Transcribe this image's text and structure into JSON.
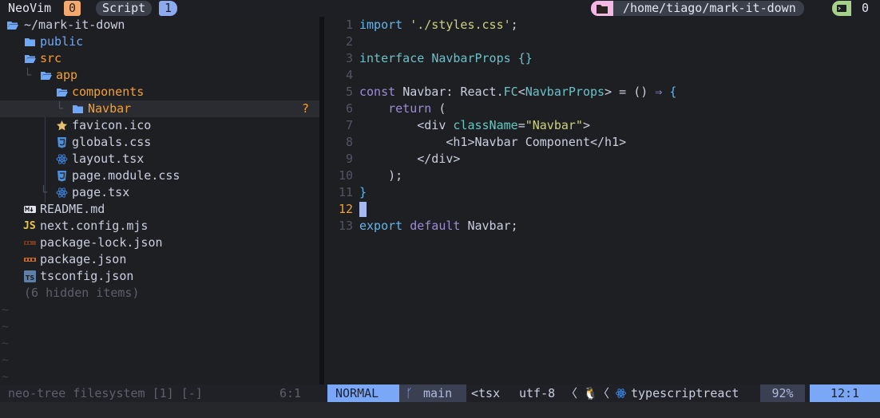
{
  "topbar": {
    "app_name": "NeoVim",
    "app_badge": "0",
    "session_name": "Script",
    "session_badge": "1",
    "path": "/home/tiago/mark-it-down",
    "terminal_count": "0"
  },
  "tree": {
    "root": "~/mark-it-down",
    "items": [
      {
        "label": "public"
      },
      {
        "label": "src"
      },
      {
        "label": "app"
      },
      {
        "label": "components"
      },
      {
        "label": "Navbar",
        "status": "?"
      },
      {
        "label": "favicon.ico"
      },
      {
        "label": "globals.css"
      },
      {
        "label": "layout.tsx"
      },
      {
        "label": "page.module.css"
      },
      {
        "label": "page.tsx"
      },
      {
        "label": "README.md"
      },
      {
        "label": "next.config.mjs"
      },
      {
        "label": "package-lock.json"
      },
      {
        "label": "package.json"
      },
      {
        "label": "tsconfig.json"
      }
    ],
    "hidden": "(6 hidden items)",
    "empty_marker": "~"
  },
  "editor": {
    "line_numbers": [
      "1",
      "2",
      "3",
      "4",
      "5",
      "6",
      "7",
      "8",
      "9",
      "10",
      "11",
      "12",
      "13"
    ],
    "tokens": {
      "l1_import": "import",
      "l1_str": "'./styles.css'",
      "l1_semi": ";",
      "l3_interface": "interface",
      "l3_name": "NavbarProps",
      "l3_braces": "{}",
      "l5_const": "const",
      "l5_navbar": "Navbar",
      "l5_colon": ":",
      "l5_react": "React",
      "l5_dot": ".",
      "l5_fc": "FC",
      "l5_lt": "<",
      "l5_props": "NavbarProps",
      "l5_gt": ">",
      "l5_eq": "=",
      "l5_parens": "()",
      "l5_arrow": "⇒",
      "l5_brace": "{",
      "l6_return": "return",
      "l6_paren": "(",
      "l7_open": "<div",
      "l7_attr": "className",
      "l7_eq": "=",
      "l7_val": "\"Navbar\"",
      "l7_close": ">",
      "l8_text": "<h1>Navbar Component</h1>",
      "l9_text": "</div>",
      "l10_text": ");",
      "l11_text": "}",
      "l13_export": "export",
      "l13_default": "default",
      "l13_name": "Navbar",
      "l13_semi": ";"
    }
  },
  "statusline": {
    "tree_label": "neo-tree filesystem [1] [-]",
    "tree_pos": "6:1",
    "mode": "NORMAL",
    "branch": "main",
    "filetype_short": "<tsx",
    "encoding": "utf-8",
    "filetype": "typescriptreact",
    "percent": "92%",
    "position": "12:1"
  },
  "colors": {
    "accent_blue": "#7aa8f7",
    "folder_blue": "#6ea8f7",
    "orange": "#f5a030",
    "pink": "#f4b8e4",
    "green": "#a6d189"
  }
}
